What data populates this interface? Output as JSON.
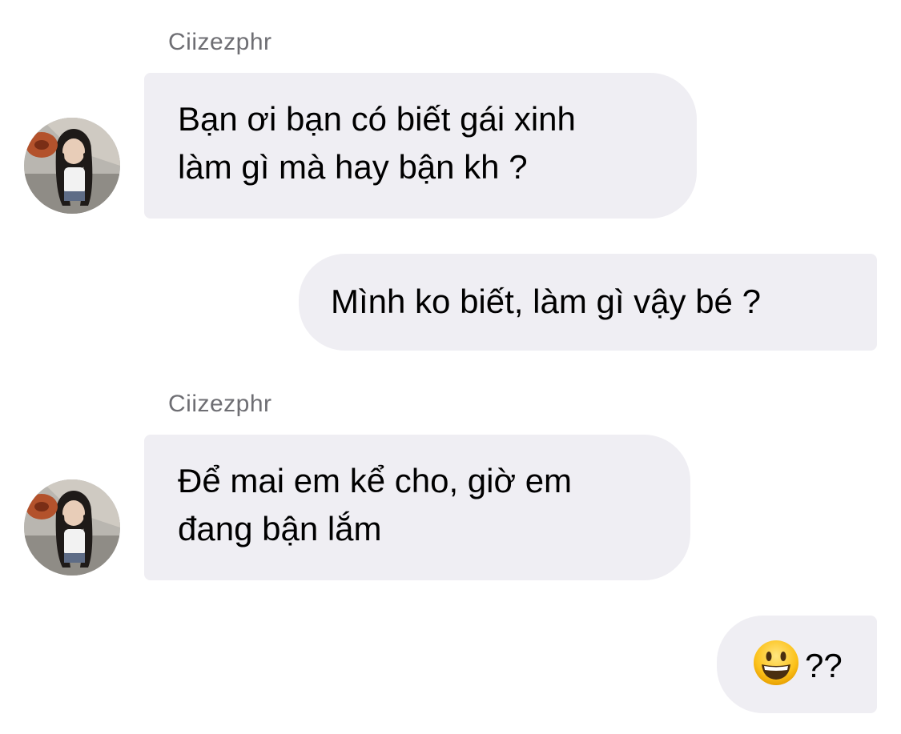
{
  "messages": [
    {
      "sender": "Ciizezphr",
      "direction": "incoming",
      "lines": [
        "Bạn ơi bạn có biết gái xinh",
        "làm gì mà hay bận kh ?"
      ]
    },
    {
      "direction": "outgoing",
      "lines": [
        "Mình ko biết, làm gì vậy bé ?"
      ]
    },
    {
      "sender": "Ciizezphr",
      "direction": "incoming",
      "lines": [
        "Để mai em kể cho, giờ em",
        "đang bận lắm"
      ]
    },
    {
      "direction": "outgoing",
      "emoji": "grinning-face-emoji",
      "text": "??"
    }
  ],
  "colors": {
    "bubble": "#efeef3",
    "sender_name": "#6e6e73",
    "text": "#000000",
    "background": "#ffffff"
  }
}
